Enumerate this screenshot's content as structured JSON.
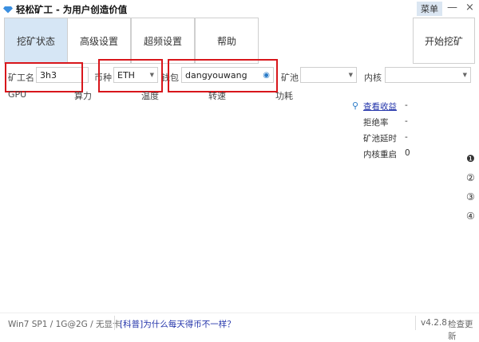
{
  "window": {
    "title": "轻松矿工 - 为用户创造价值",
    "menu": "菜单",
    "minimize": "—",
    "close": "×"
  },
  "tabs": [
    {
      "label": "挖矿状态"
    },
    {
      "label": "高级设置"
    },
    {
      "label": "超频设置"
    },
    {
      "label": "帮助"
    }
  ],
  "start_button": "开始挖矿",
  "form": {
    "miner_label": "矿工名",
    "miner_value": "3h3",
    "coin_label": "币种",
    "coin_value": "ETH",
    "wallet_label": "钱包",
    "wallet_value": "dangyouwang",
    "pool_label": "矿池",
    "pool_value": "",
    "core_label": "内核",
    "core_value": ""
  },
  "columns": [
    "GPU",
    "算力",
    "温度",
    "转速",
    "功耗"
  ],
  "stats": [
    {
      "label": "查看收益",
      "value": "-"
    },
    {
      "label": "拒绝率",
      "value": "-"
    },
    {
      "label": "矿池延时",
      "value": "-"
    },
    {
      "label": "内核重启",
      "value": "0"
    }
  ],
  "pages": [
    "❶",
    "②",
    "③",
    "④"
  ],
  "footer": {
    "sysinfo": "Win7 SP1 / 1G@2G / 无显卡",
    "link": "[科普]为什么每天得币不一样？",
    "version": "v4.2.8",
    "update": "检查更新"
  },
  "colors": {
    "accent": "#d6e6f5",
    "highlight": "#d8161b",
    "link": "#2233aa"
  }
}
